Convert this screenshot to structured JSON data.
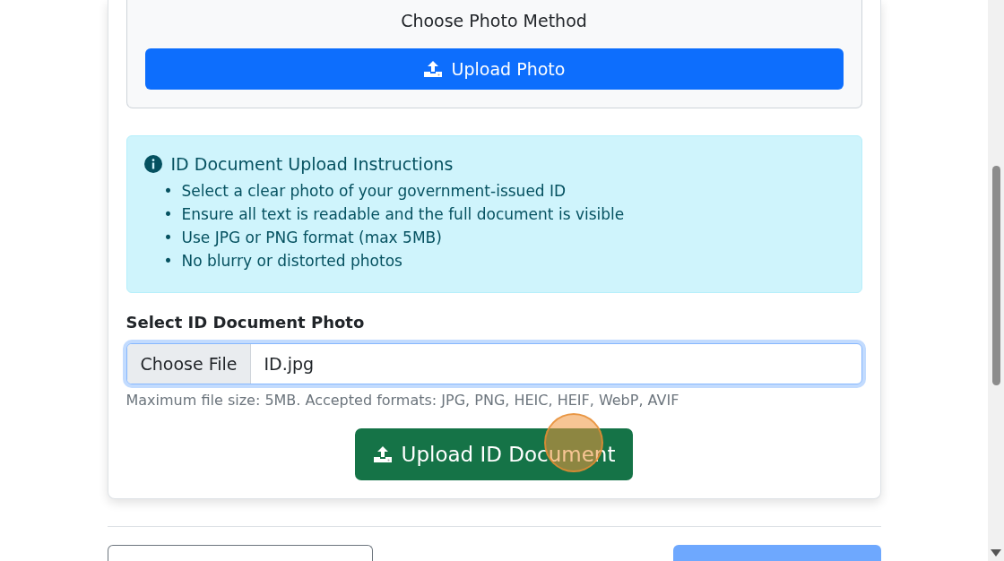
{
  "photo_method": {
    "title": "Choose Photo Method",
    "button": "Upload Photo"
  },
  "instructions": {
    "title": "ID Document Upload Instructions",
    "items": [
      {
        "marker": "•",
        "text": "Select a clear photo of your government-issued ID"
      },
      {
        "marker": "•",
        "text": "Ensure all text is readable and the full document is visible"
      },
      {
        "marker": "•",
        "text": "Use JPG or PNG format (max 5MB)"
      },
      {
        "marker": "•",
        "text": "No blurry or distorted photos"
      }
    ]
  },
  "file_field": {
    "label": "Select ID Document Photo",
    "button": "Choose File",
    "value": "ID.jpg",
    "help": "Maximum file size: 5MB. Accepted formats: JPG, PNG, HEIC, HEIF, WebP, AVIF"
  },
  "submit_button": "Upload ID Document"
}
